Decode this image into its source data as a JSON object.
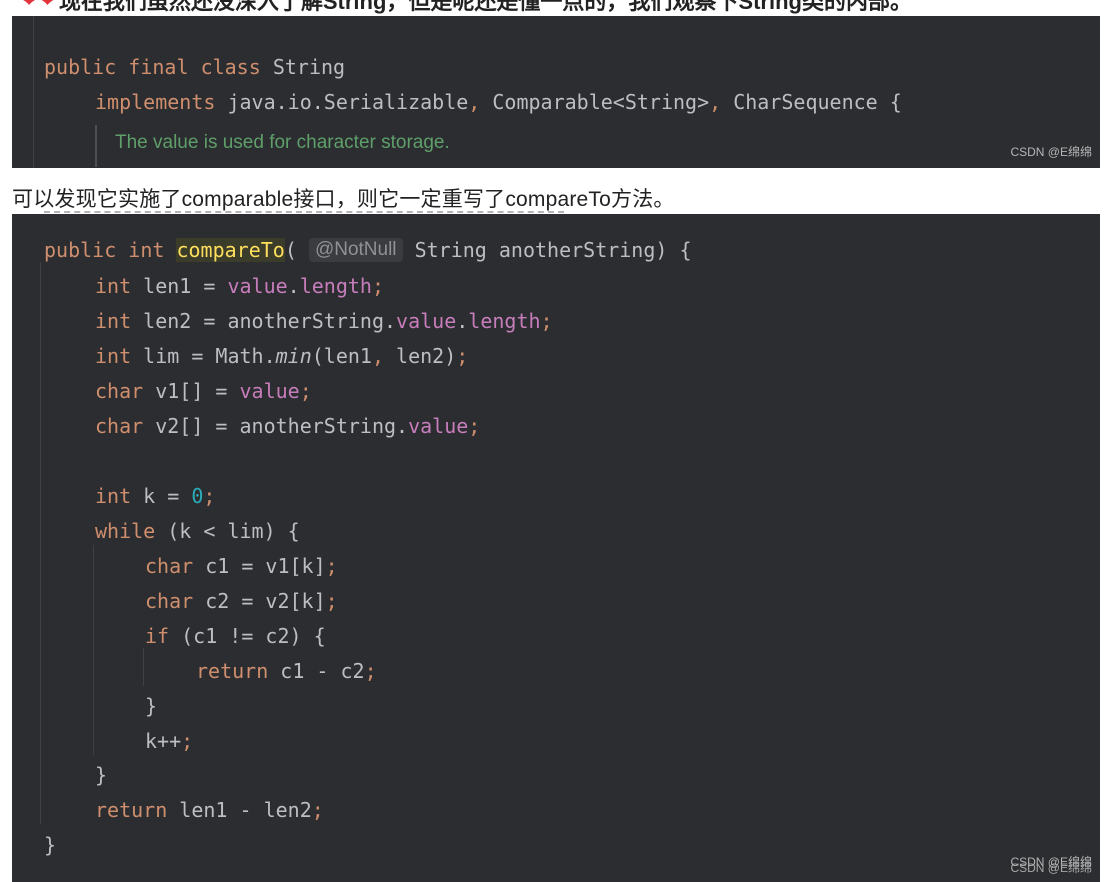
{
  "heading": {
    "hearts": "❤❤",
    "text": "现在我们虽然还没深入了解String，但是呢还是懂一点的，我们观察下String类的内部。"
  },
  "block1": {
    "line1": {
      "kw1": "public",
      "kw2": "final",
      "kw3": "class",
      "name": "String"
    },
    "line2": {
      "kw": "implements",
      "rest1": " java.io.Serializable",
      "comma1": ",",
      "rest2": " Comparable<String>",
      "comma2": ",",
      "rest3": " CharSequence {"
    },
    "comment": "The value is used for character storage."
  },
  "prose": "可以发现它实施了comparable接口，则它一定重写了compareTo方法。",
  "block2": {
    "sig": {
      "kw1": "public",
      "kw2": "int",
      "fn": "compareTo",
      "paren": "(",
      "hint": "@NotNull",
      "rest": " String anotherString) {"
    },
    "l1": {
      "kw": "int",
      "a": " len1 = ",
      "f1": "value",
      "dot": ".",
      "f2": "length",
      "semi": ";"
    },
    "l2": {
      "kw": "int",
      "a": " len2 = anotherString.",
      "f1": "value",
      "dot": ".",
      "f2": "length",
      "semi": ";"
    },
    "l3": {
      "kw": "int",
      "a": " lim = Math.",
      "call": "min",
      "b": "(len1",
      "comma": ",",
      "c": " len2)",
      "semi": ";"
    },
    "l4": {
      "kw": "char",
      "a": " v1[] = ",
      "f1": "value",
      "semi": ";"
    },
    "l5": {
      "kw": "char",
      "a": " v2[] = anotherString.",
      "f1": "value",
      "semi": ";"
    },
    "l6": {
      "kw": "int",
      "a": " k = ",
      "num": "0",
      "semi": ";"
    },
    "l7": {
      "kw": "while",
      "a": " (k < lim) {"
    },
    "l8": {
      "kw": "char",
      "a": " c1 = v1[k]",
      "semi": ";"
    },
    "l9": {
      "kw": "char",
      "a": " c2 = v2[k]",
      "semi": ";"
    },
    "l10": {
      "kw": "if",
      "a": " (c1 != c2) {"
    },
    "l11": {
      "kw": "return",
      "a": " c1 - c2",
      "semi": ";"
    },
    "l12": {
      "a": "}"
    },
    "l13": {
      "a": "k++",
      "semi": ";"
    },
    "l14": {
      "a": "}"
    },
    "l15": {
      "kw": "return",
      "a": " len1 - len2",
      "semi": ";"
    },
    "l16": {
      "a": "}"
    }
  },
  "watermarks": {
    "w1": "CSDN @E绵绵",
    "w2": "CSDN @E绵绵",
    "w3": "CSDN @E绵绵"
  }
}
